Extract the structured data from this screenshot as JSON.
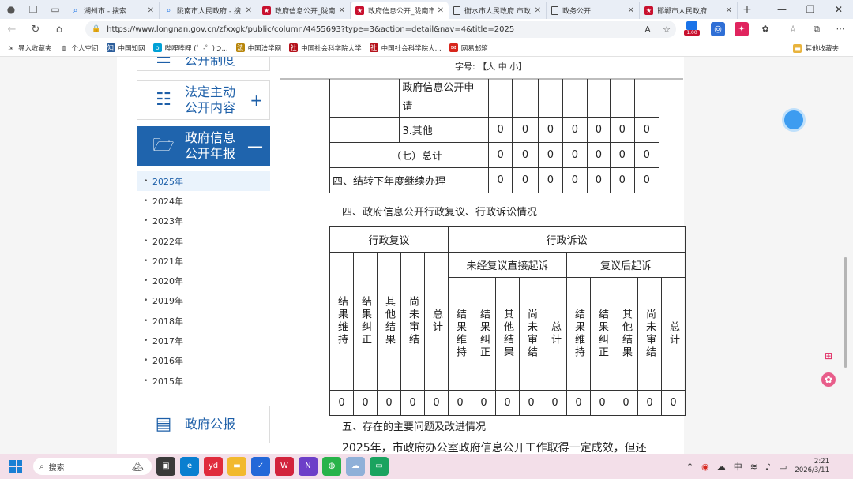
{
  "browser": {
    "tabs": [
      {
        "icon": "search-icon",
        "title": "湖州市 - 搜索",
        "active": false
      },
      {
        "icon": "search-icon",
        "title": "陇南市人民政府 - 搜",
        "active": false
      },
      {
        "icon": "gov-icon",
        "title": "政府信息公开_陇南",
        "active": false
      },
      {
        "icon": "gov-icon",
        "title": "政府信息公开_陇南市",
        "active": true
      },
      {
        "icon": "doc-icon",
        "title": "衡水市人民政府 市政",
        "active": false
      },
      {
        "icon": "doc-icon",
        "title": "政务公开",
        "active": false
      },
      {
        "icon": "gov-icon",
        "title": "邯郸市人民政府",
        "active": false
      }
    ],
    "url": "https://www.longnan.gov.cn/zfxxgk/public/column/4455693?type=3&action=detail&nav=4&title=2025",
    "ext_badge": "1.00",
    "bookmarks": [
      "导入收藏夹",
      "个人空间",
      "中国知网",
      "哔哩哔哩 (゜-゜)つ...",
      "中国法学网",
      "中国社会科学院大学",
      "中国社会科学院大...",
      "网易邮箱"
    ],
    "other_bookmarks": "其他收藏夹"
  },
  "sidebar": {
    "blocks": [
      {
        "label": "公开制度"
      },
      {
        "label": "法定主动公开内容",
        "line1": "法定主动",
        "line2": "公开内容",
        "toggle": "+"
      },
      {
        "label": "政府信息公开年报",
        "line1": "政府信息",
        "line2": "公开年报",
        "toggle": "—"
      },
      {
        "label": "政府公报"
      }
    ],
    "years": [
      "2025年",
      "2024年",
      "2023年",
      "2022年",
      "2021年",
      "2020年",
      "2019年",
      "2018年",
      "2017年",
      "2016年",
      "2015年"
    ],
    "active_year": "2025年"
  },
  "article": {
    "font_size_label": "字号: 【大 中 小】",
    "top_table": {
      "rows": [
        {
          "label": "政府信息公开申请",
          "l1": "政府信息公开申",
          "l2": "请",
          "values": [
            "",
            "",
            "",
            "",
            "",
            "",
            ""
          ]
        },
        {
          "label": "3.其他",
          "values": [
            "0",
            "0",
            "0",
            "0",
            "0",
            "0",
            "0"
          ]
        },
        {
          "label": "（七）总计",
          "values": [
            "0",
            "0",
            "0",
            "0",
            "0",
            "0",
            "0"
          ]
        },
        {
          "label": "四、结转下年度继续办理",
          "values": [
            "0",
            "0",
            "0",
            "0",
            "0",
            "0",
            "0"
          ]
        }
      ]
    },
    "section4_heading": "四、政府信息公开行政复议、行政诉讼情况",
    "review_table": {
      "group1": "行政复议",
      "group2": "行政诉讼",
      "sub1": "未经复议直接起诉",
      "sub2": "复议后起诉",
      "headers": [
        "结果维持",
        "结果纠正",
        "其他结果",
        "尚未审结",
        "总计",
        "结果维持",
        "结果纠正",
        "其他结果",
        "尚未审结",
        "总计",
        "结果维持",
        "结果纠正",
        "其他结果",
        "尚未审结",
        "总计"
      ],
      "values": [
        "0",
        "0",
        "0",
        "0",
        "0",
        "0",
        "0",
        "0",
        "0",
        "0",
        "0",
        "0",
        "0",
        "0",
        "0"
      ]
    },
    "section5_heading": "五、存在的主要问题及改进情况",
    "section5_text": "2025年，市政府办公室政府信息公开工作取得一定成效，但还"
  },
  "taskbar": {
    "search_placeholder": "搜索",
    "ime": "中",
    "time": "2:21",
    "date": "2026/3/11"
  }
}
